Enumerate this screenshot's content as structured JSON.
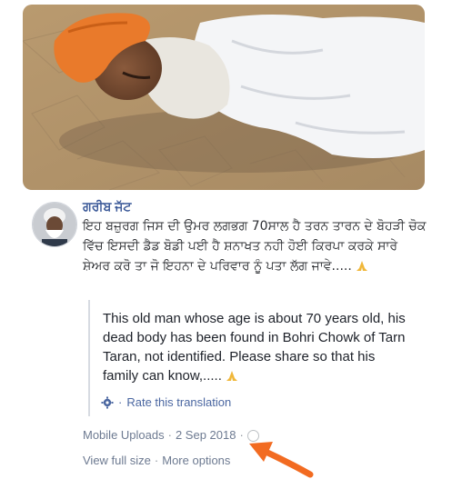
{
  "post": {
    "author": "ਗਰੀਬ ਜੱਟ",
    "original_text": "ਇਹ ਬਜ਼ੁਰਗ ਜਿਸ ਦੀ ਉਮਰ ਲਗਭਗ 70ਸਾਲ ਹੈ ਤਰਨ ਤਾਰਨ ਦੇ ਬੋਹੜੀ ਚੋਕ ਵਿੱਚ ਇਸਦੀ ਡੈਡ ਬੋਡੀ ਪਈ ਹੈ ਸ਼ਨਾਖਤ ਨਹੀ ਹੋਈ ਕਿਰਪਾ ਕਰਕੇ ਸਾਰੇ ਸ਼ੇਅਰ ਕਰੋ ਤਾ ਜੋ ਇਹਨਾ ਦੇ ਪਰਿਵਾਰ ਨੂੰ ਪਤਾ ਲੱਗ ਜਾਵੇ.....",
    "translation": "This old man whose age is about 70 years old, his dead body has been found in Bohri Chowk of Tarn Taran, not identified. Please share so that his family can know,.....",
    "rate_label": "Rate this translation",
    "source": "Mobile Uploads",
    "separator": "·",
    "date": "2 Sep 2018",
    "view_full_size": "View full size",
    "more_options": "More options"
  },
  "colors": {
    "link_blue": "#4b67a1",
    "author_blue": "#3b5998",
    "meta_gray": "#8d949e",
    "arrow_orange": "#f26b21"
  },
  "icons": {
    "rate": "gear-icon",
    "privacy": "globe-icon",
    "emoji": "folded-hands-icon",
    "annotation": "arrow-icon"
  }
}
